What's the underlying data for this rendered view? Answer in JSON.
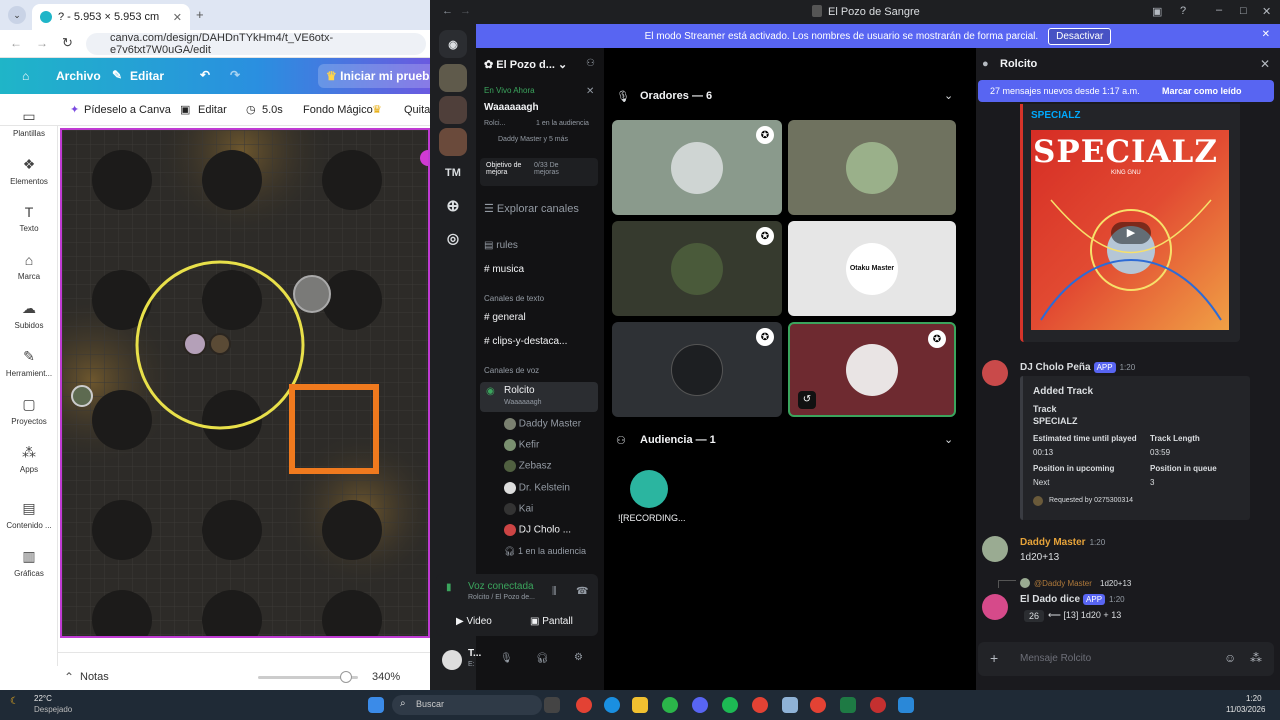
{
  "chrome": {
    "tab_title": "? - 5.953 × 5.953 cm",
    "url": "canva.com/design/DAHDnTYkHm4/t_VE6otx-e7v6txt7W0uGA/edit"
  },
  "canva": {
    "archivo": "Archivo",
    "editar": "Editar",
    "iniciar": "Iniciar mi prueba po",
    "toolbar": {
      "pideselo": "Pídeselo a Canva",
      "editar": "Editar",
      "duration": "5.0s",
      "fondo": "Fondo Mágico",
      "quita": "Quita"
    },
    "sidebar": [
      "Plantillas",
      "Elementos",
      "Texto",
      "Marca",
      "Subidos",
      "Herramient...",
      "Proyectos",
      "Apps",
      "Contenido ...",
      "Gráficas"
    ],
    "notas": "Notas",
    "zoom": "340%"
  },
  "discord": {
    "window_title": "El Pozo de Sangre",
    "banner_text": "El modo Streamer está activado. Los nombres de usuario se mostrarán de forma parcial.",
    "banner_button": "Desactivar",
    "server_tm": "TM",
    "server_name": "El Pozo d...",
    "live": {
      "label": "En Vivo Ahora",
      "title": "Waaaaaagh",
      "line1_user": "Rolci...",
      "line1_aud": "1 en la audiencia",
      "line2": "Daddy Master y 5 más"
    },
    "boost": {
      "label": "Objetivo de mejora",
      "value": "0/33 De mejoras"
    },
    "explore": "Explorar canales",
    "channels_top": [
      "rules",
      "musica"
    ],
    "text_header": "Canales de texto",
    "text_channels": [
      "general",
      "clips-y-destaca..."
    ],
    "voice_header": "Canales de voz",
    "voice_channel": {
      "name": "Rolcito",
      "sub": "Waaaaaagh"
    },
    "voice_members": [
      "Daddy Master",
      "Kefir",
      "Zebasz",
      "Dr. Kelstein",
      "Kai",
      "DJ Cholo ..."
    ],
    "audience_line": "1 en la audiencia",
    "connected": {
      "title": "Voz conectada",
      "sub": "Rolcito / El Pozo de...",
      "video": "Video",
      "screen": "Pantall"
    },
    "user": {
      "name": "T...",
      "status": "E:"
    },
    "stage": {
      "speakers_header": "Oradores — 6",
      "audience_header": "Audiencia — 1",
      "audience_name": "![RECORDING...",
      "otaku_label": "Otaku Master"
    },
    "thread": {
      "title": "Rolcito",
      "new_messages": "27 mensajes nuevos desde 1:17 a.m.",
      "mark_read": "Marcar como leído",
      "embed_title": "SPECIALZ",
      "album_title": "SPECIALZ",
      "album_artist": "KING GNU",
      "bot_name": "DJ Cholo Peña",
      "app_badge": "APP",
      "bot_time": "1:20",
      "added_track": "Added Track",
      "track_label": "Track",
      "track_value": "SPECIALZ",
      "est_label": "Estimated time until played",
      "est_value": "00:13",
      "len_label": "Track Length",
      "len_value": "03:59",
      "pos_up_label": "Position in upcoming",
      "pos_up_value": "Next",
      "pos_q_label": "Position in queue",
      "pos_q_value": "3",
      "requested": "Requested by 0275300314",
      "daddy_name": "Daddy Master",
      "daddy_time": "1:20",
      "daddy_msg": "1d20+13",
      "reply_user": "@Daddy Master",
      "reply_text": "1d20+13",
      "dado_name": "El Dado dice",
      "dado_time": "1:20",
      "dado_result": "26",
      "dado_detail": "⟵ [13] 1d20 + 13",
      "input_placeholder": "Mensaje Rolcito"
    }
  },
  "taskbar": {
    "temp": "22°C",
    "weather": "Despejado",
    "search": "Buscar",
    "time": "1:20",
    "date": "11/03/2026"
  },
  "colors": {
    "blurple": "#5865f2",
    "discord_bg": "#000000",
    "canva_border": "#c03bd3",
    "ring": "#e8e04a",
    "square": "#f07a1e"
  }
}
